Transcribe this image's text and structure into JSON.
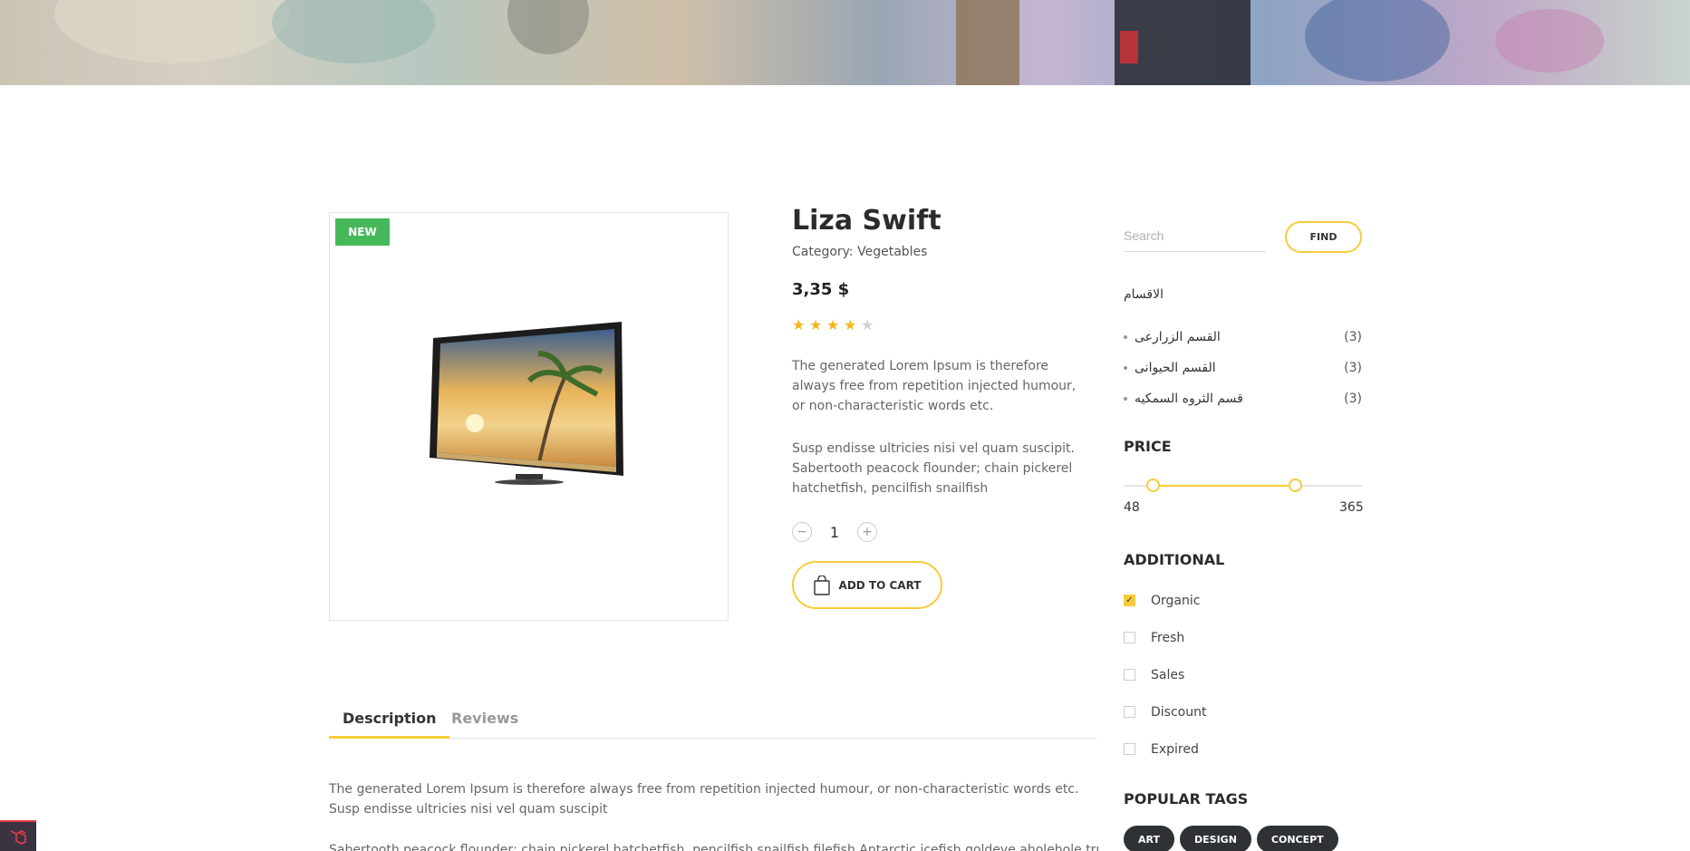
{
  "product": {
    "badge": "NEW",
    "title": "Liza Swift",
    "category": "Category: Vegetables",
    "price": "3,35 $",
    "rating": 4,
    "rating_max": 5,
    "description_1": "The generated Lorem Ipsum is therefore always free from repetition injected humour, or non-characteristic words etc.",
    "description_2": "Susp endisse ultricies nisi vel quam suscipit. Sabertooth peacock flounder; chain pickerel hatchetfish, pencilfish snailfish",
    "quantity": "1",
    "add_to_cart_label": "ADD TO CART"
  },
  "tabs": {
    "items": [
      {
        "label": "Description",
        "active": true
      },
      {
        "label": "Reviews",
        "active": false
      }
    ],
    "content_1": "The generated Lorem Ipsum is therefore always free from repetition injected humour, or non-characteristic words etc. Susp endisse ultricies nisi vel quam suscipit",
    "content_2": "Sabertooth peacock flounder; chain pickerel hatchetfish, pencilfish snailfish filefish Antarctic icefish goldeye aholehole trumpetfish"
  },
  "sidebar": {
    "search": {
      "placeholder": "Search",
      "button_label": "FIND"
    },
    "categories": {
      "heading": "الاقسام",
      "items": [
        {
          "label": "القسم الزرارعى",
          "count": "(3)"
        },
        {
          "label": "القسم الحيوانى",
          "count": "(3)"
        },
        {
          "label": "قسم الثروه السمكيه",
          "count": "(3)"
        }
      ]
    },
    "price": {
      "heading": "PRICE",
      "min": "48",
      "max": "365",
      "range_start_fraction": 0.12,
      "range_end_fraction": 0.72
    },
    "additional": {
      "heading": "ADDITIONAL",
      "items": [
        {
          "label": "Organic",
          "checked": true
        },
        {
          "label": "Fresh",
          "checked": false
        },
        {
          "label": "Sales",
          "checked": false
        },
        {
          "label": "Discount",
          "checked": false
        },
        {
          "label": "Expired",
          "checked": false
        }
      ]
    },
    "tags": {
      "heading": "POPULAR TAGS",
      "items": [
        "ART",
        "DESIGN",
        "CONCEPT"
      ]
    }
  },
  "colors": {
    "accent": "#f6cc3a",
    "badge_green": "#46b85a",
    "star": "#f7b51b",
    "tag_bg": "#2f3234"
  },
  "icons": {
    "star": "star-icon",
    "bag": "shopping-bag-icon",
    "minus": "minus-icon",
    "plus": "plus-icon",
    "check": "check-icon"
  }
}
